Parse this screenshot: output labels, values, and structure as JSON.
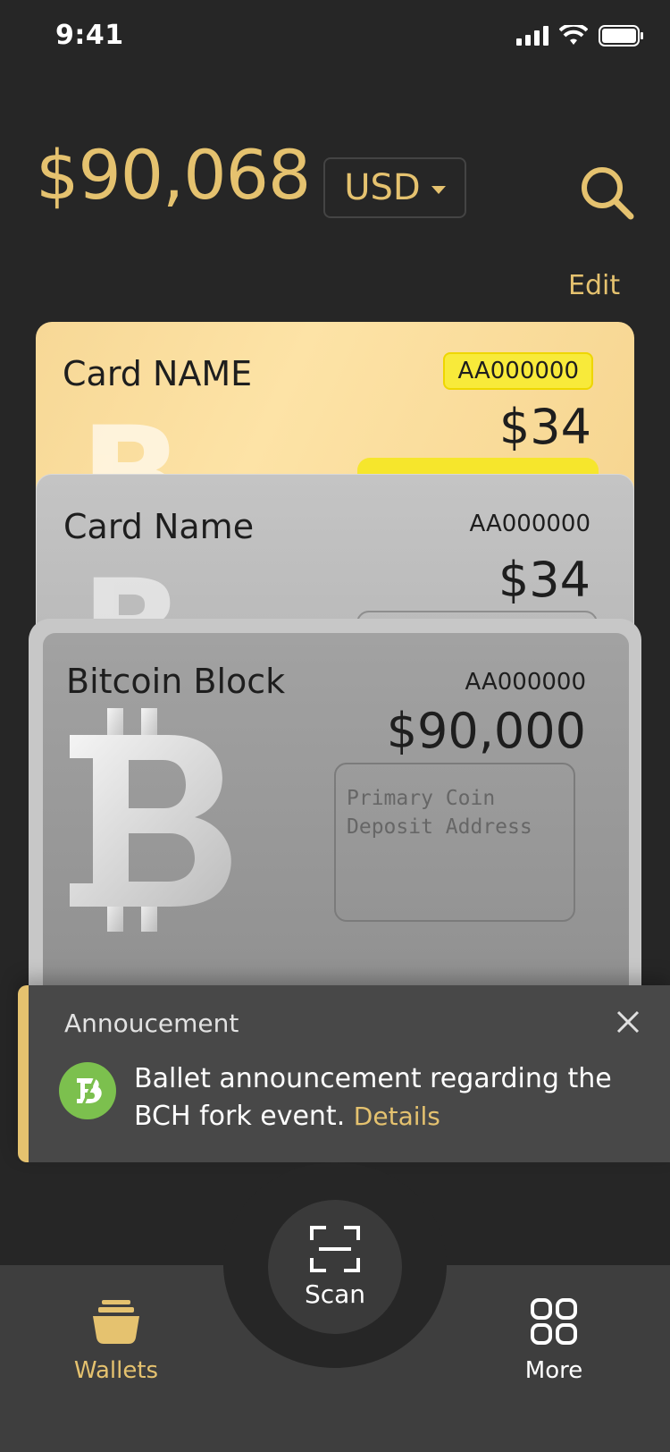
{
  "status": {
    "time": "9:41",
    "icons": [
      "cellular-signal-icon",
      "wifi-icon",
      "battery-icon"
    ]
  },
  "header": {
    "balance": "$90,068",
    "currency": "USD",
    "edit_label": "Edit"
  },
  "cards": [
    {
      "name": "Card NAME",
      "id": "AA000000",
      "amount": "$34",
      "style": "gold"
    },
    {
      "name": "Card Name",
      "id": "AA000000",
      "amount": "$34",
      "style": "silver"
    },
    {
      "name": "Bitcoin Block",
      "id": "AA000000",
      "amount": "$90,000",
      "style": "gray",
      "deposit_placeholder_line1": "Primary Coin",
      "deposit_placeholder_line2": "Deposit Address"
    }
  ],
  "announcement": {
    "title": "Annoucement",
    "message": "Ballet announcement regarding the BCH fork event.",
    "link": "Details"
  },
  "tabbar": {
    "wallets_label": "Wallets",
    "scan_label": "Scan",
    "more_label": "More"
  },
  "colors": {
    "accent": "#e5c26f",
    "background": "#262626",
    "tabbar": "#3e3e3e",
    "badge": "#f8ea3a",
    "logo_green": "#7cc04e"
  }
}
